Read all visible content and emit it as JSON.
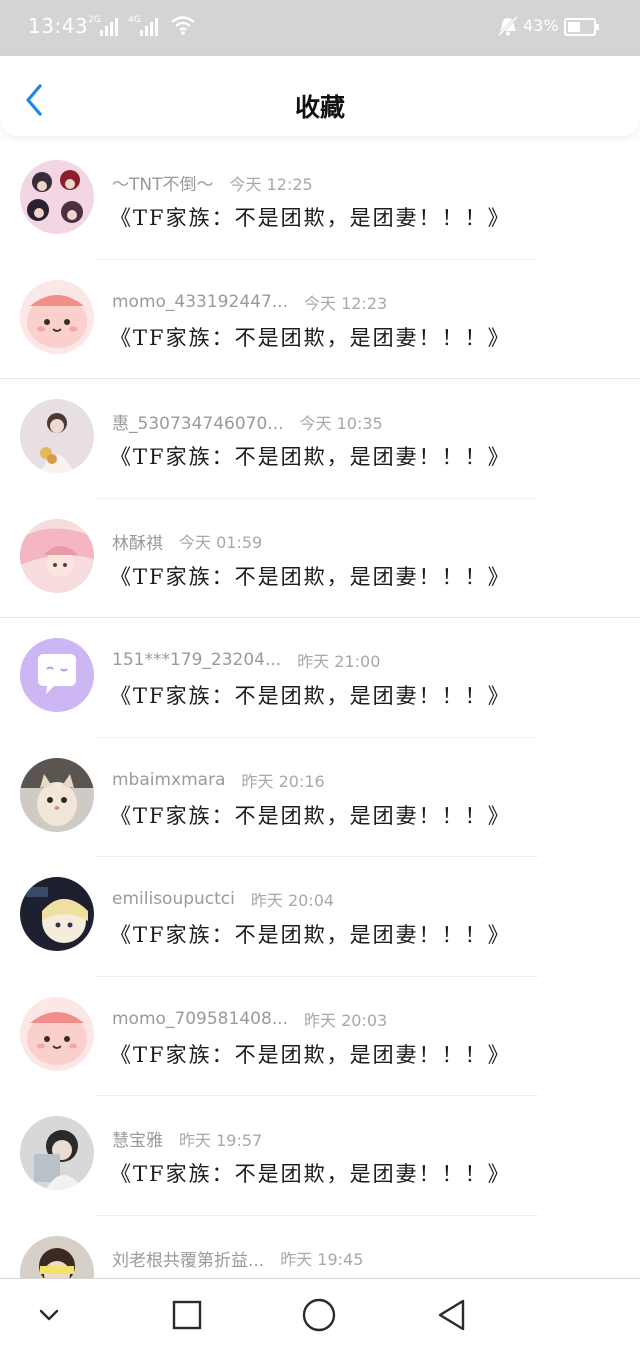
{
  "status_bar": {
    "time": "13:43",
    "signal_1_label": "2G",
    "signal_2_label": "4G",
    "battery_text": "43%",
    "icons": [
      "signal-icon",
      "signal-icon",
      "wifi-icon",
      "mute-bell-icon",
      "battery-icon"
    ]
  },
  "header": {
    "title": "收藏",
    "back_icon": "back-chevron-icon",
    "accent_color": "#1e88e5"
  },
  "favorites": [
    {
      "username": "～TNT不倒～",
      "time": "今天 12:25",
      "message": "《TF家族：不是团欺，是团妻！！！》",
      "avatar": "group-photo"
    },
    {
      "username": "momo_433192447...",
      "time": "今天 12:23",
      "message": "《TF家族：不是团欺，是团妻！！！》",
      "avatar": "pink-cartoon"
    },
    {
      "username": "惠_530734746070...",
      "time": "今天 10:35",
      "message": "《TF家族：不是团欺，是团妻！！！》",
      "avatar": "girl-photo"
    },
    {
      "username": "林酥祺",
      "time": "今天 01:59",
      "message": "《TF家族：不是团欺，是团妻！！！》",
      "avatar": "anime-pink"
    },
    {
      "username": "151***179_23204...",
      "time": "昨天 21:00",
      "message": "《TF家族：不是团欺，是团妻！！！》",
      "avatar": "purple-chat"
    },
    {
      "username": "mbaimxmara",
      "time": "昨天 20:16",
      "message": "《TF家族：不是团欺，是团妻！！！》",
      "avatar": "cat-photo"
    },
    {
      "username": "emilisoupuctci",
      "time": "昨天 20:04",
      "message": "《TF家族：不是团欺，是团妻！！！》",
      "avatar": "anime-dark"
    },
    {
      "username": "momo_709581408...",
      "time": "昨天 20:03",
      "message": "《TF家族：不是团欺，是团妻！！！》",
      "avatar": "pink-cartoon"
    },
    {
      "username": "慧宝雅",
      "time": "昨天 19:57",
      "message": "《TF家族：不是团欺，是团妻！！！》",
      "avatar": "grey-photo"
    },
    {
      "username": "刘老根共覆第折益...",
      "time": "昨天 19:45",
      "message": "",
      "avatar": "yellow-photo"
    }
  ],
  "nav_bar": {
    "icons": [
      "collapse-chevron-icon",
      "recent-apps-square-icon",
      "home-circle-icon",
      "back-triangle-icon"
    ]
  }
}
